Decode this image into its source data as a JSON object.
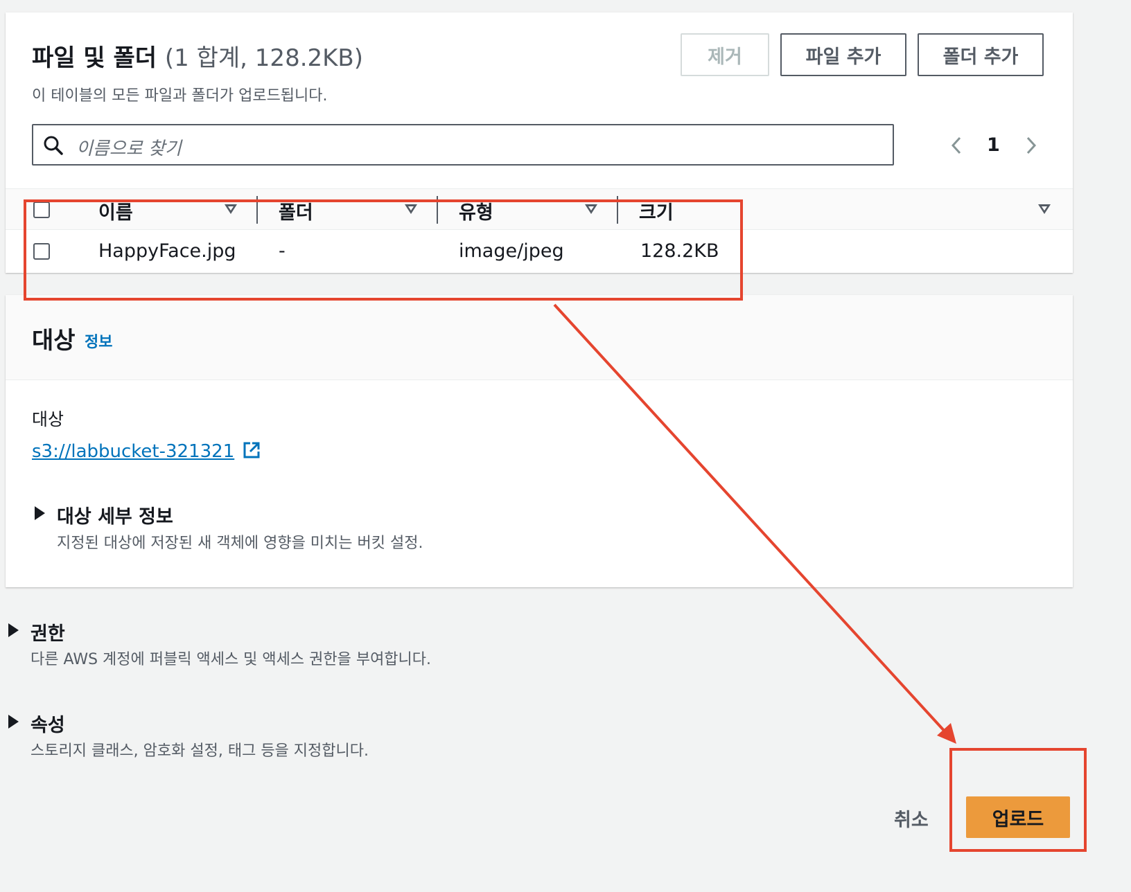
{
  "files": {
    "title": "파일 및 폴더",
    "count_summary": "(1 합계, 128.2KB)",
    "description": "이 테이블의 모든 파일과 폴더가 업로드됩니다.",
    "remove_label": "제거",
    "add_files_label": "파일 추가",
    "add_folder_label": "폴더 추가",
    "search_placeholder": "이름으로 찾기",
    "page_number": "1",
    "columns": [
      "이름",
      "폴더",
      "유형",
      "크기"
    ],
    "rows": [
      {
        "name": "HappyFace.jpg",
        "folder": "-",
        "type": "image/jpeg",
        "size": "128.2KB"
      }
    ]
  },
  "destination": {
    "title": "대상",
    "info_link": "정보",
    "field_label": "대상",
    "bucket_link": "s3://labbucket-321321",
    "details_title": "대상 세부 정보",
    "details_desc": "지정된 대상에 저장된 새 객체에 영향을 미치는 버킷 설정."
  },
  "permissions": {
    "title": "권한",
    "desc": "다른 AWS 계정에 퍼블릭 액세스 및 액세스 권한을 부여합니다."
  },
  "properties": {
    "title": "속성",
    "desc": "스토리지 클래스, 암호화 설정, 태그 등을 지정합니다."
  },
  "footer": {
    "cancel_label": "취소",
    "upload_label": "업로드"
  },
  "colors": {
    "accent_orange": "#ec9a3c",
    "link_blue": "#0073bb",
    "annotation_red": "#e5452f"
  },
  "icons": [
    "search-icon",
    "chevron-left-icon",
    "chevron-right-icon",
    "sort-icon",
    "external-link-icon",
    "caret-right-icon"
  ]
}
